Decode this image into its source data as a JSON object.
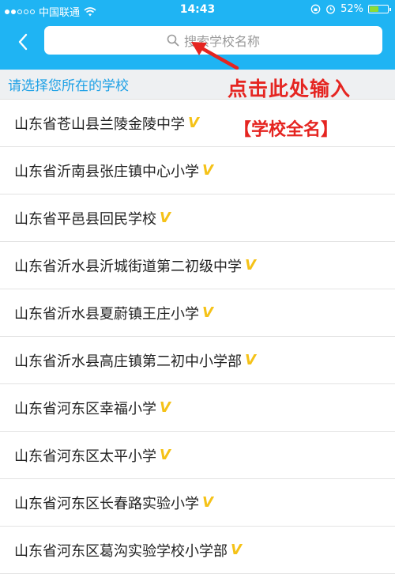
{
  "status_bar": {
    "carrier": "中国联通",
    "time": "14:43",
    "battery": "52%",
    "battery_level": 0.52
  },
  "header": {
    "back_icon": "chevron-left-icon",
    "search_placeholder": "搜索学校名称",
    "search_icon": "search-icon"
  },
  "annotation": {
    "primary": "点击此处输入",
    "secondary": "【学校全名】",
    "color": "#e52521"
  },
  "section": {
    "title": "请选择您所在的学校"
  },
  "colors": {
    "header_bg": "#1fb4f3",
    "accent": "#1fa1e6",
    "verified": "#f5c218"
  },
  "schools": [
    {
      "name": "山东省苍山县兰陵金陵中学",
      "verified": "V"
    },
    {
      "name": "山东省沂南县张庄镇中心小学",
      "verified": "V"
    },
    {
      "name": "山东省平邑县回民学校",
      "verified": "V"
    },
    {
      "name": "山东省沂水县沂城街道第二初级中学",
      "verified": "V"
    },
    {
      "name": "山东省沂水县夏蔚镇王庄小学",
      "verified": "V"
    },
    {
      "name": "山东省沂水县高庄镇第二初中小学部",
      "verified": "V"
    },
    {
      "name": "山东省河东区幸福小学",
      "verified": "V"
    },
    {
      "name": "山东省河东区太平小学",
      "verified": "V"
    },
    {
      "name": "山东省河东区长春路实验小学",
      "verified": "V"
    },
    {
      "name": "山东省河东区葛沟实验学校小学部",
      "verified": "V"
    }
  ]
}
